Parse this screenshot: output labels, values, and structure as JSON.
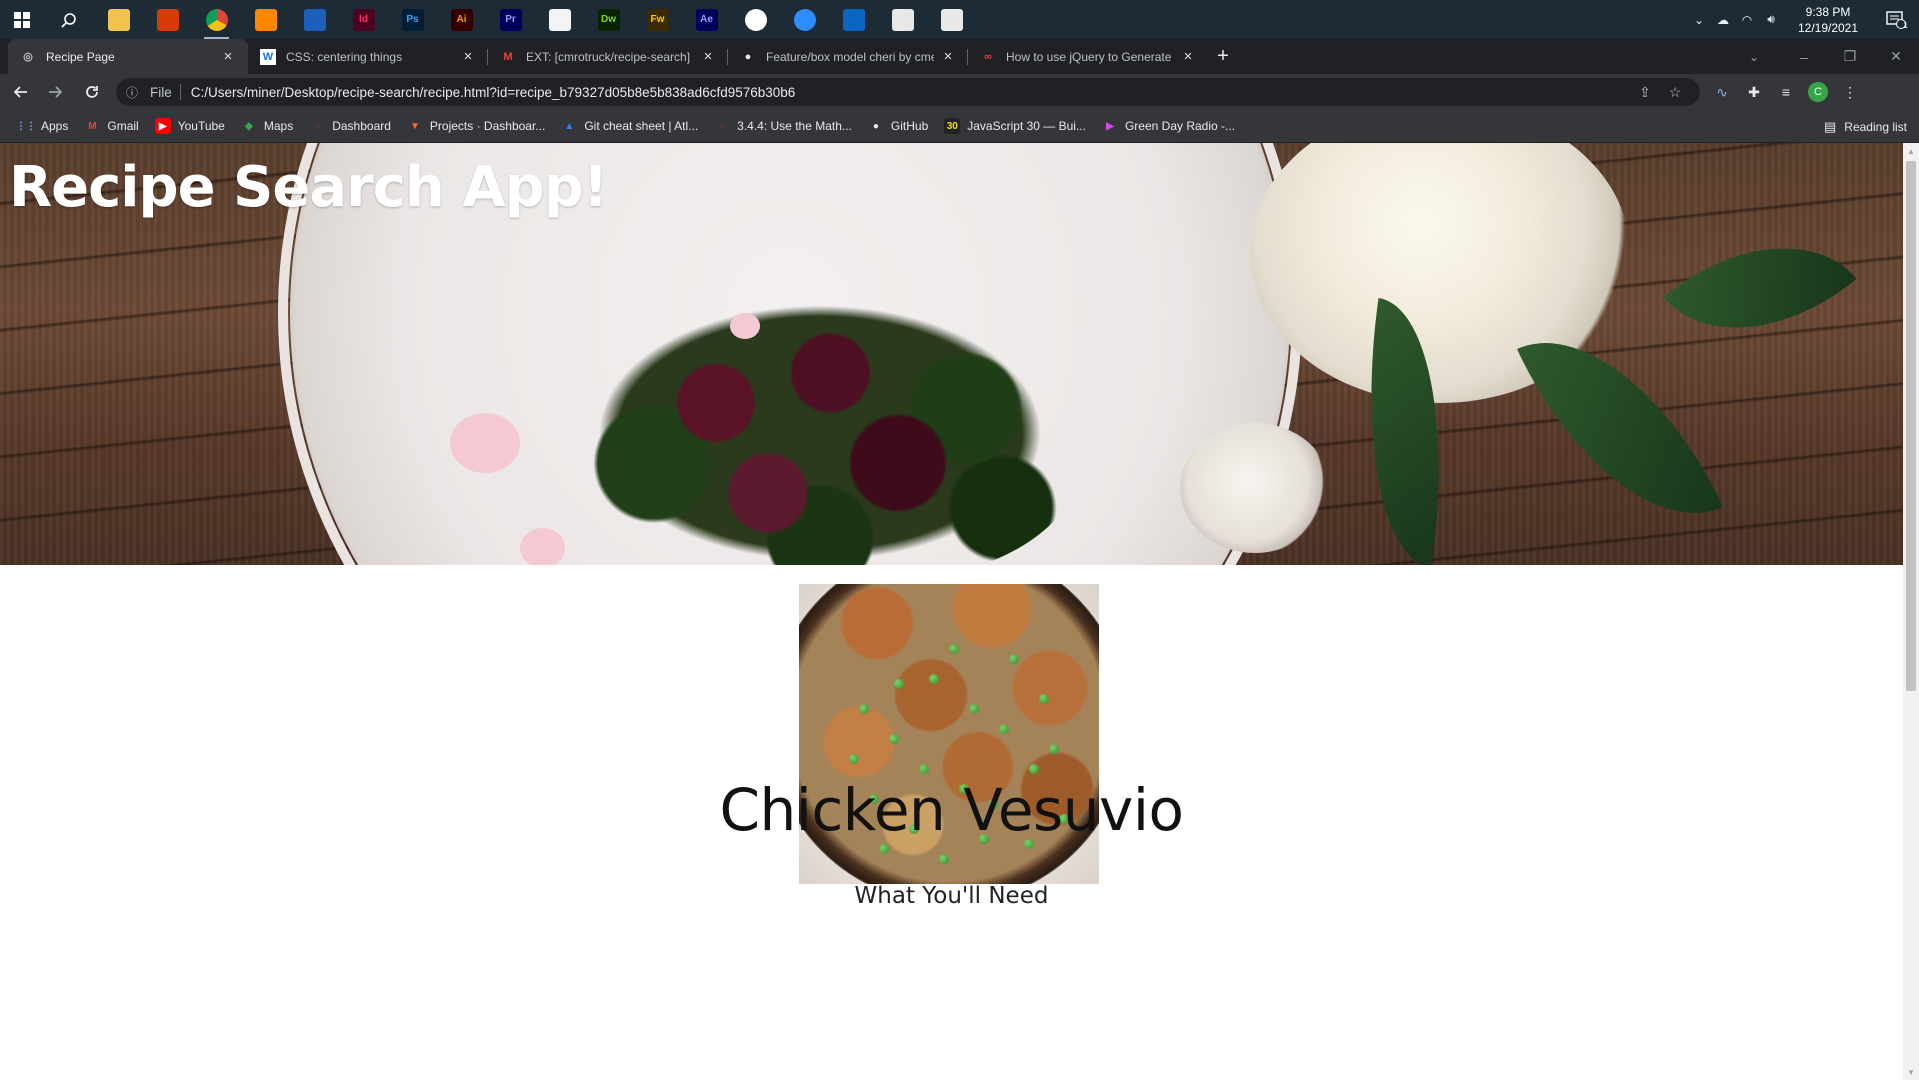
{
  "taskbar": {
    "apps": [
      {
        "name": "file-explorer-icon",
        "glyph": "",
        "bg": "#f2c14e",
        "fg": "#7a5a12"
      },
      {
        "name": "office-icon",
        "glyph": "",
        "bg": "#d83b01",
        "fg": "#fff"
      },
      {
        "name": "chrome-icon",
        "glyph": "",
        "bg": "#dd4b39",
        "fg": "#fff"
      },
      {
        "name": "vlc-icon",
        "glyph": "",
        "bg": "#ff8800",
        "fg": "#fff"
      },
      {
        "name": "app-icon",
        "glyph": "",
        "bg": "#1d5fb9",
        "fg": "#fff"
      },
      {
        "name": "indesign-icon",
        "glyph": "Id",
        "bg": "#49021f",
        "fg": "#ff3366"
      },
      {
        "name": "photoshop-icon",
        "glyph": "Ps",
        "bg": "#001e36",
        "fg": "#31a8ff"
      },
      {
        "name": "illustrator-icon",
        "glyph": "Ai",
        "bg": "#330000",
        "fg": "#ff9a00"
      },
      {
        "name": "premiere-icon",
        "glyph": "Pr",
        "bg": "#00005b",
        "fg": "#9999ff"
      },
      {
        "name": "acrobat-icon",
        "glyph": "",
        "bg": "#f4f4f4",
        "fg": "#d7262e"
      },
      {
        "name": "dreamweaver-icon",
        "glyph": "Dw",
        "bg": "#072401",
        "fg": "#7ed321"
      },
      {
        "name": "fireworks-icon",
        "glyph": "Fw",
        "bg": "#3b2b00",
        "fg": "#ffcc00"
      },
      {
        "name": "after-effects-icon",
        "glyph": "Ae",
        "bg": "#00005b",
        "fg": "#9999ff"
      },
      {
        "name": "slack-icon",
        "glyph": "",
        "bg": "#ffffff",
        "fg": "#e01e5a"
      },
      {
        "name": "zoom-icon",
        "glyph": "",
        "bg": "#2d8cff",
        "fg": "#fff"
      },
      {
        "name": "vscode-icon",
        "glyph": "",
        "bg": "#0a66c2",
        "fg": "#fff"
      },
      {
        "name": "git-icon",
        "glyph": "",
        "bg": "#e8e8e8",
        "fg": "#333"
      },
      {
        "name": "git-icon",
        "glyph": "",
        "bg": "#e8e8e8",
        "fg": "#333"
      }
    ],
    "clock": {
      "time": "9:38 PM",
      "date": "12/19/2021"
    },
    "notification_count": "1"
  },
  "tabs": [
    {
      "title": "Recipe Page",
      "active": true,
      "favicon": "globe-icon",
      "glyph": "◎",
      "fav_bg": "transparent",
      "fav_fg": "#bdc1c6"
    },
    {
      "title": "CSS: centering things",
      "active": false,
      "favicon": "w3-icon",
      "glyph": "W",
      "fav_bg": "#fff",
      "fav_fg": "#1a73e8"
    },
    {
      "title": "EXT: [cmrotruck/recipe-search] F",
      "active": false,
      "favicon": "gmail-icon",
      "glyph": "M",
      "fav_bg": "transparent",
      "fav_fg": "#ea4335"
    },
    {
      "title": "Feature/box model cheri by cme",
      "active": false,
      "favicon": "github-icon",
      "glyph": "●",
      "fav_bg": "transparent",
      "fav_fg": "#e8eaed"
    },
    {
      "title": "How to use jQuery to Generate I",
      "active": false,
      "favicon": "codepen-icon",
      "glyph": "∞",
      "fav_bg": "transparent",
      "fav_fg": "#ea4335"
    }
  ],
  "toolbar": {
    "scheme": "File",
    "url": "C:/Users/miner/Desktop/recipe-search/recipe.html?id=recipe_b79327d05b8e5b838ad6cfd9576b30b6",
    "profile_initial": "C"
  },
  "bookmarks": [
    {
      "label": "Apps",
      "icon": "apps-grid-icon",
      "glyph": "⋮⋮",
      "bg": "transparent",
      "fg": "#8ab4f8"
    },
    {
      "label": "Gmail",
      "icon": "gmail-icon",
      "glyph": "M",
      "bg": "transparent",
      "fg": "#ea4335"
    },
    {
      "label": "YouTube",
      "icon": "youtube-icon",
      "glyph": "▶",
      "bg": "#ff0000",
      "fg": "#fff"
    },
    {
      "label": "Maps",
      "icon": "maps-icon",
      "glyph": "◆",
      "bg": "transparent",
      "fg": "#34a853"
    },
    {
      "label": "Dashboard",
      "icon": "dashboard-icon",
      "glyph": "◌",
      "bg": "transparent",
      "fg": "#ea4335"
    },
    {
      "label": "Projects · Dashboar...",
      "icon": "gitlab-icon",
      "glyph": "▼",
      "bg": "transparent",
      "fg": "#fc6d26"
    },
    {
      "label": "Git cheat sheet | Atl...",
      "icon": "atlassian-icon",
      "glyph": "▲",
      "bg": "transparent",
      "fg": "#2684ff"
    },
    {
      "label": "3.4.4: Use the Math...",
      "icon": "dashboard-icon",
      "glyph": "◌",
      "bg": "transparent",
      "fg": "#ea4335"
    },
    {
      "label": "GitHub",
      "icon": "github-icon",
      "glyph": "●",
      "bg": "transparent",
      "fg": "#e8eaed"
    },
    {
      "label": "JavaScript 30 — Bui...",
      "icon": "js30-icon",
      "glyph": "30",
      "bg": "#222",
      "fg": "#f7df1e"
    },
    {
      "label": "Green Day Radio -...",
      "icon": "pandora-icon",
      "glyph": "▶",
      "bg": "transparent",
      "fg": "#d946ef"
    }
  ],
  "reading_list": "Reading list",
  "page": {
    "app_title": "Recipe Search App!",
    "recipe_title": "Chicken Vesuvio",
    "section_heading": "What You'll Need"
  }
}
